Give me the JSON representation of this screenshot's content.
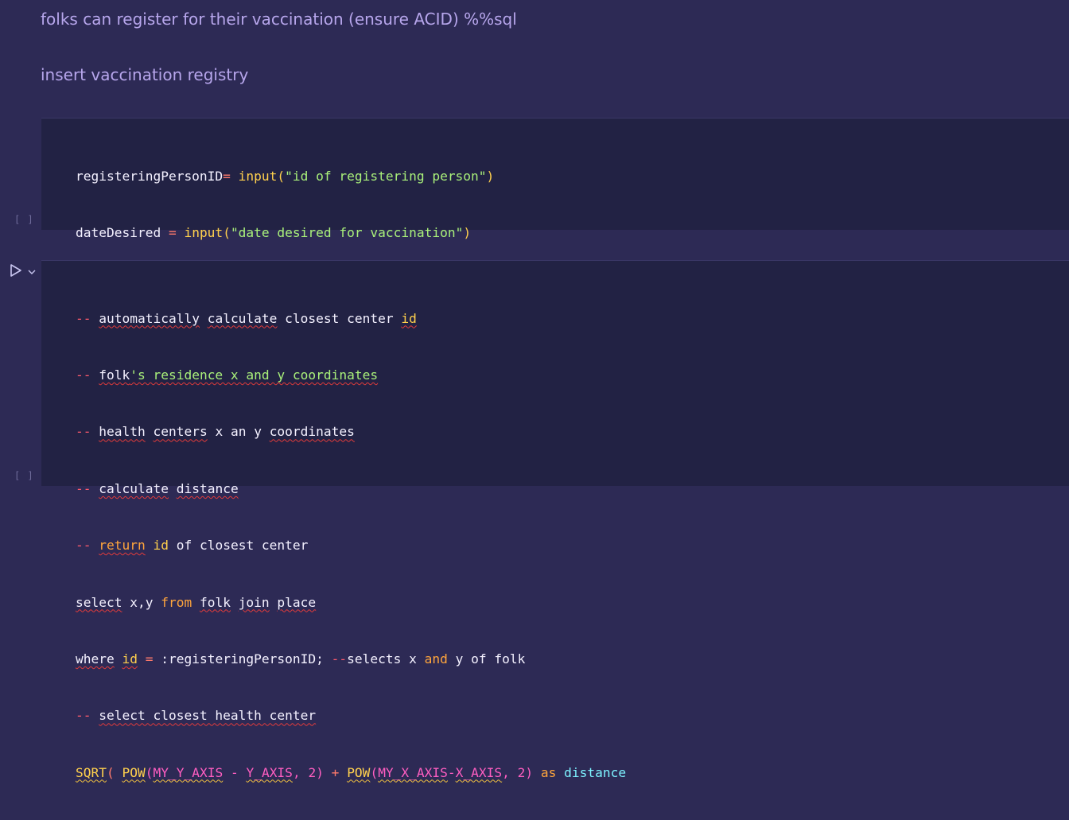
{
  "markdown": {
    "line1": "folks can register for their vaccination (ensure ACID) %%sql",
    "line2": "insert vaccination registry"
  },
  "cell1": {
    "exec_count": "[ ]",
    "line1": {
      "var": "registeringPersonID",
      "op": "=",
      "fn": " input",
      "paren_open": "(",
      "str": "\"id of registering person\"",
      "paren_close": ")"
    },
    "line2": {
      "var": "dateDesired ",
      "op": "=",
      "fn": " input",
      "paren_open": "(",
      "str": "\"date desired for vaccination\"",
      "paren_close": ")"
    }
  },
  "cell2": {
    "exec_count": "[ ]",
    "comments": {
      "c1": {
        "dash": "-- ",
        "w1": "automatically",
        "sp1": " ",
        "w2": "calculate",
        "rest": " closest center ",
        "w3": "id"
      },
      "c2": {
        "dash": "-- ",
        "w1": "folk",
        "rest": "'s residence x and y coordinates"
      },
      "c3": {
        "dash": "-- ",
        "w1": "health",
        "sp1": " ",
        "w2": "centers",
        "rest": " x an y ",
        "w3": "coordinates"
      },
      "c4": {
        "dash": "-- ",
        "w1": "calculate",
        "sp1": " ",
        "w2": "distance"
      },
      "c5": {
        "dash": "-- ",
        "kw": "return",
        "sp1": " ",
        "kw2": "id",
        "rest": " of closest center"
      },
      "c6": {
        "dash": "-- ",
        "rest": "select closest health center"
      }
    },
    "select_line": {
      "kw1": "select",
      "t1": " x,y ",
      "kw2": "from",
      "t2": " ",
      "w1": "folk",
      "t3": " ",
      "w2": "join",
      "t4": " ",
      "w3": "place"
    },
    "where_line": {
      "kw1": "where",
      "t1": " ",
      "kw2": "id",
      "t2": " ",
      "op": "=",
      "t3": " :registeringPersonID; ",
      "cm": "--",
      "t4": "selects x ",
      "kw3": "and",
      "t5": " y of folk"
    },
    "sqrt_line": {
      "fn1": "SQRT",
      "p1": "( ",
      "fn2": "POW",
      "p2": "(",
      "a1": "MY_Y_AXIS",
      "op1": " - ",
      "a2": "Y_AXIS",
      "c1": ", ",
      "n1": "2",
      "p3": ")",
      "op2": " + ",
      "fn3": "POW",
      "p4": "(",
      "a3": "MY_X_AXIS",
      "op3": "-",
      "a4": "X_AXIS",
      "c2": ", ",
      "n2": "2",
      "p5": ")",
      "kw": " as ",
      "id": "distance"
    }
  }
}
